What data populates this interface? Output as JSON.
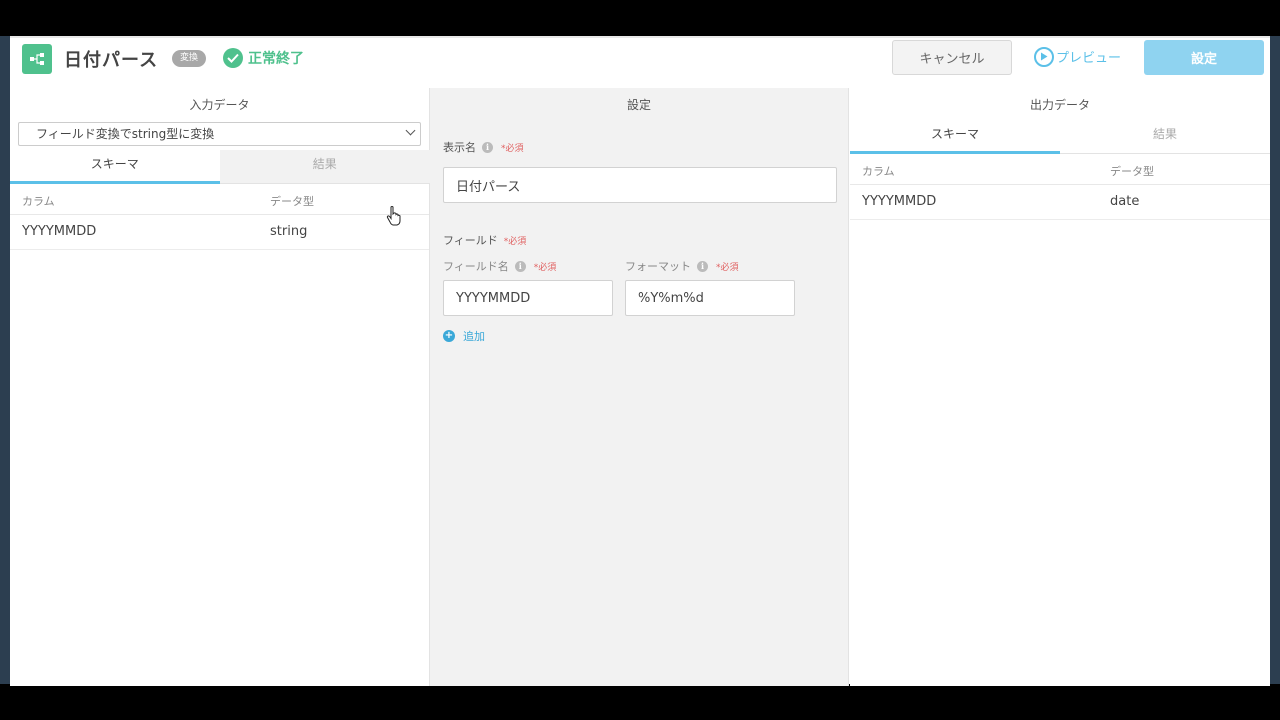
{
  "header": {
    "title": "日付パース",
    "tag": "変換",
    "status": "正常終了",
    "cancel_label": "キャンセル",
    "preview_label": "プレビュー",
    "settings_label": "設定"
  },
  "input_panel": {
    "title": "入力データ",
    "source_select": "フィールド変換でstring型に変換",
    "tabs": [
      {
        "label": "スキーマ",
        "active": true
      },
      {
        "label": "結果",
        "active": false
      }
    ],
    "columns": [
      "カラム",
      "データ型"
    ],
    "rows": [
      {
        "column": "YYYYMMDD",
        "type": "string"
      }
    ]
  },
  "settings_panel": {
    "title": "設定",
    "display_name_label": "表示名",
    "required": "*必須",
    "display_name_value": "日付パース",
    "field_section_label": "フィールド",
    "field_name_label": "フィールド名",
    "format_label": "フォーマット",
    "field_name_value": "YYYYMMDD",
    "format_value": "%Y%m%d",
    "add_label": "追加"
  },
  "output_panel": {
    "title": "出力データ",
    "tabs": [
      {
        "label": "スキーマ",
        "active": true
      },
      {
        "label": "結果",
        "active": false
      }
    ],
    "columns": [
      "カラム",
      "データ型"
    ],
    "rows": [
      {
        "column": "YYYYMMDD",
        "type": "date"
      }
    ]
  },
  "colors": {
    "accent": "#5bc0e8",
    "success": "#4fc18d",
    "required": "#e06060"
  }
}
